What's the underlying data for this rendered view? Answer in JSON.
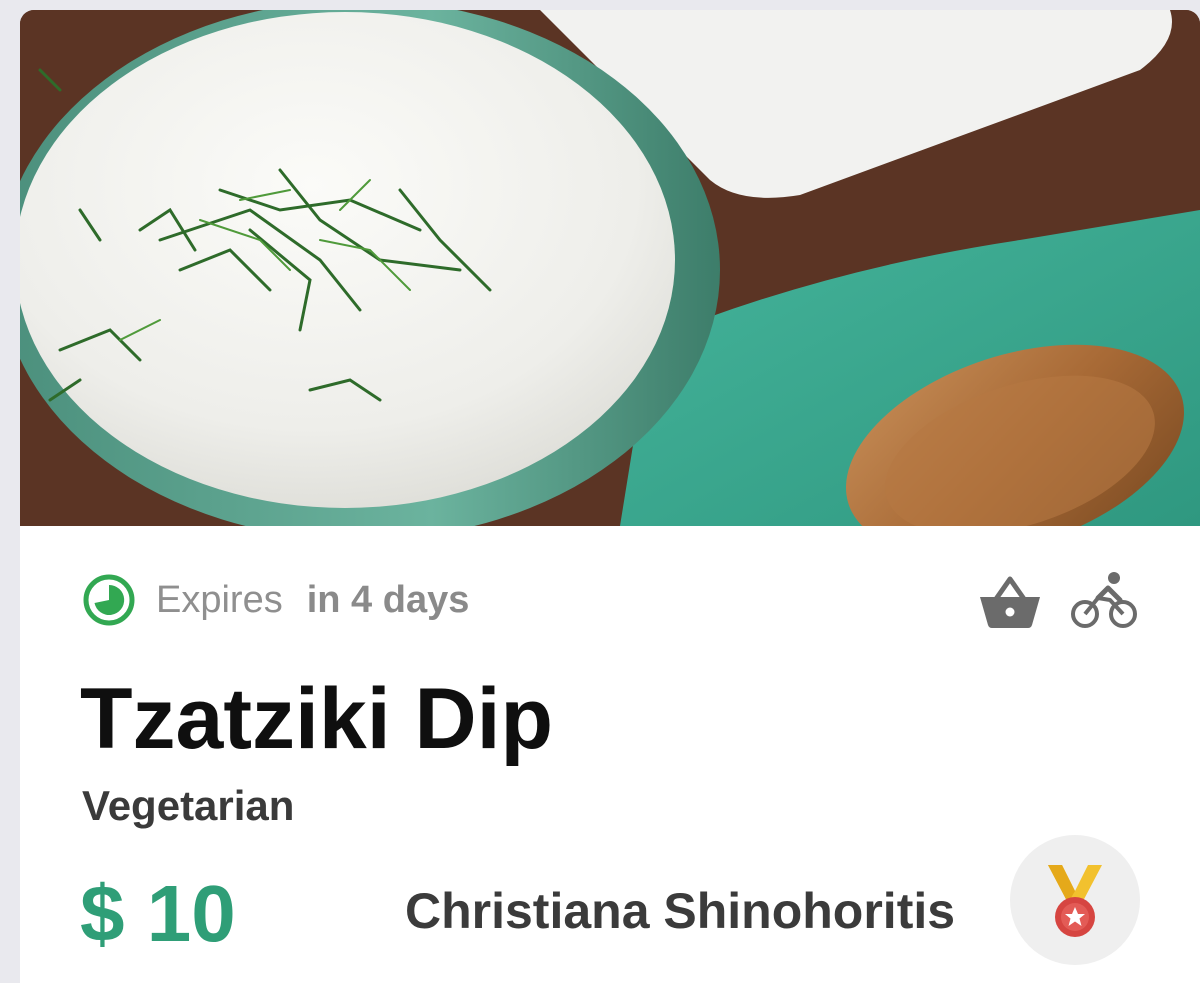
{
  "listing": {
    "image": {
      "subject": "bowl-of-tzatziki-with-dill-and-wooden-spoon"
    },
    "expires": {
      "label": "Expires",
      "value": "in 4 days",
      "icon": "clock-icon",
      "icon_color": "#32a852"
    },
    "delivery_options": [
      {
        "icon": "basket-icon"
      },
      {
        "icon": "bicycle-icon"
      }
    ],
    "title": "Tzatziki Dip",
    "category": "Vegetarian",
    "price": "$ 10",
    "seller": {
      "name": "Christiana Shinohoritis",
      "badge_icon": "medal-icon"
    }
  },
  "colors": {
    "price": "#2f9e77",
    "icon_gray": "#6b6b6b",
    "badge_bg": "#efefef"
  }
}
